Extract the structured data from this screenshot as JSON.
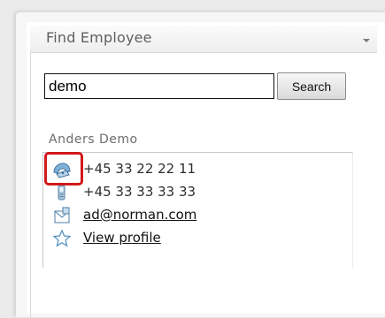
{
  "webpart": {
    "title": "Find Employee",
    "menu_icon": "chevron-down-icon"
  },
  "search": {
    "value": "demo",
    "button_label": "Search"
  },
  "employee": {
    "name": "Anders Demo",
    "phone": "+45 33 22 22 11",
    "mobile": "+45 33 33 33 33",
    "email": "ad@norman.com",
    "profile_link": "View profile",
    "icons": {
      "phone": "phone-icon",
      "mobile": "mobile-phone-icon",
      "email": "email-icon",
      "profile": "star-icon"
    }
  },
  "colors": {
    "highlight": "#d1191c",
    "title_text": "#5f5f5f"
  }
}
